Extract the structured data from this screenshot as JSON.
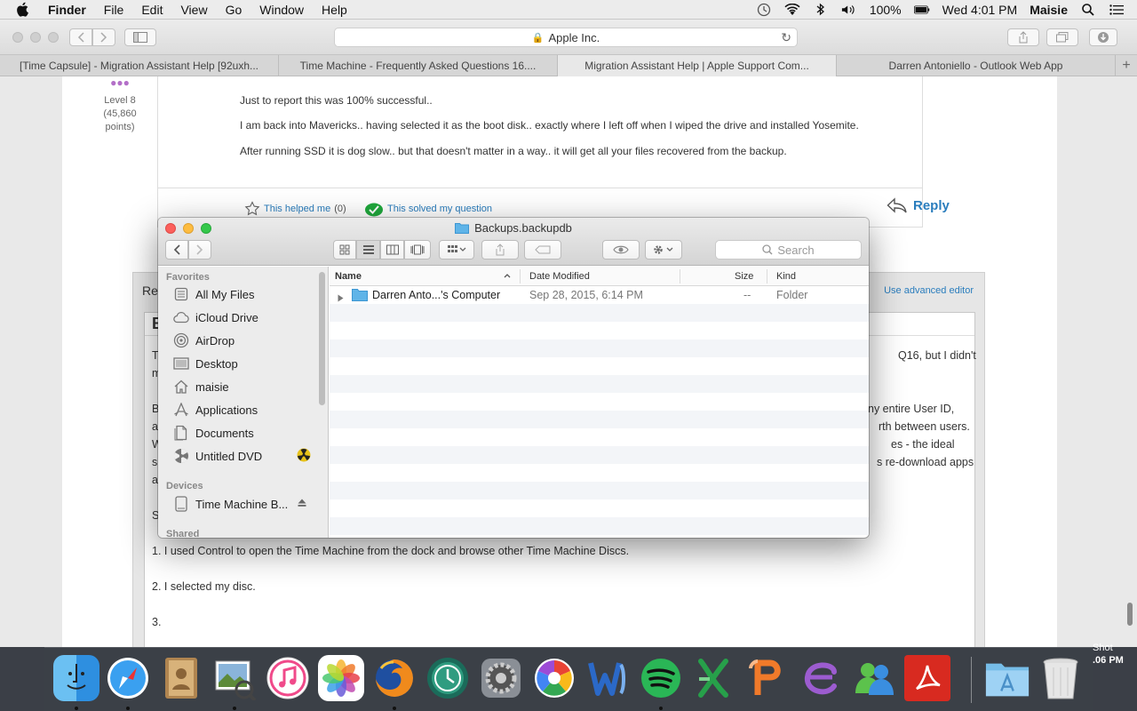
{
  "menubar": {
    "app_name": "Finder",
    "menus": [
      "File",
      "Edit",
      "View",
      "Go",
      "Window",
      "Help"
    ],
    "battery": "100%",
    "clock": "Wed 4:01 PM",
    "user": "Maisie"
  },
  "safari": {
    "address": "Apple Inc.",
    "tabs": [
      "[Time Capsule] - Migration Assistant Help [92uxh...",
      "Time Machine - Frequently Asked Questions 16....",
      "Migration Assistant Help | Apple Support Com...",
      "Darren Antoniello - Outlook Web App"
    ]
  },
  "post": {
    "author_level": "Level 8",
    "author_points": "(45,860",
    "author_points_unit": "points)",
    "lines": [
      "Just to report this was 100% successful..",
      "I am back into Mavericks.. having selected it as the boot disk.. exactly where I left off when I wiped the drive and installed Yosemite.",
      "After running SSD it is dog slow.. but that doesn't matter in a way.. it will get all your files recovered from the backup."
    ],
    "helped_label": "This helped me",
    "helped_count": "(0)",
    "solved_label": "This solved my question",
    "reply_label": "Reply"
  },
  "reply_area": {
    "label": "Re",
    "advanced_editor": "Use advanced editor",
    "bold_button": "B",
    "editor_lines": [
      {
        "text": "T",
        "right": "Q16, but I didn't"
      },
      {
        "text": "m",
        "right": ""
      },
      {
        "text": "B",
        "right": "ny entire User ID,"
      },
      {
        "text": "a",
        "right": "rth between users."
      },
      {
        "text": "W",
        "right": "es - the ideal"
      },
      {
        "text": "si",
        "right": "s re-download apps"
      },
      {
        "text": "a",
        "right": ""
      },
      {
        "text": "S",
        "right": ""
      }
    ],
    "steps": [
      "1. I used Control to open the Time Machine from the dock and browse other Time Machine Discs.",
      "2. I selected my disc.",
      "3."
    ]
  },
  "finder": {
    "title": "Backups.backupdb",
    "search_placeholder": "Search",
    "sidebar": {
      "favorites_header": "Favorites",
      "favorites": [
        {
          "label": "All My Files",
          "icon": "all-files-icon"
        },
        {
          "label": "iCloud Drive",
          "icon": "cloud-icon"
        },
        {
          "label": "AirDrop",
          "icon": "airdrop-icon"
        },
        {
          "label": "Desktop",
          "icon": "desktop-icon"
        },
        {
          "label": "maisie",
          "icon": "home-icon"
        },
        {
          "label": "Applications",
          "icon": "applications-icon"
        },
        {
          "label": "Documents",
          "icon": "documents-icon"
        },
        {
          "label": "Untitled DVD",
          "icon": "dvd-icon"
        }
      ],
      "devices_header": "Devices",
      "devices": [
        {
          "label": "Time Machine B...",
          "icon": "drive-icon"
        }
      ],
      "shared_header": "Shared"
    },
    "columns": {
      "name": "Name",
      "date_modified": "Date Modified",
      "size": "Size",
      "kind": "Kind"
    },
    "rows": [
      {
        "name": "Darren Anto...'s Computer",
        "date": "Sep 28, 2015, 6:14 PM",
        "size": "--",
        "kind": "Folder"
      }
    ]
  },
  "dock": {
    "apps": [
      "Finder",
      "Safari",
      "Contacts",
      "Preview",
      "iTunes",
      "Photos",
      "Firefox",
      "Time Machine",
      "System Preferences",
      "Picasa",
      "Word",
      "Spotify",
      "Excel",
      "PowerPoint",
      "Entourage",
      "Messenger",
      "Acrobat",
      "Applications",
      "Trash"
    ],
    "desktop_label_1": "Shot",
    "desktop_label_2": ".06 PM"
  },
  "colors": {
    "link_blue": "#2a7dbd",
    "close_red": "#fc605c",
    "minimize_yellow": "#fdbc40",
    "zoom_green": "#34c84a",
    "folder_blue": "#5fb4e8"
  }
}
